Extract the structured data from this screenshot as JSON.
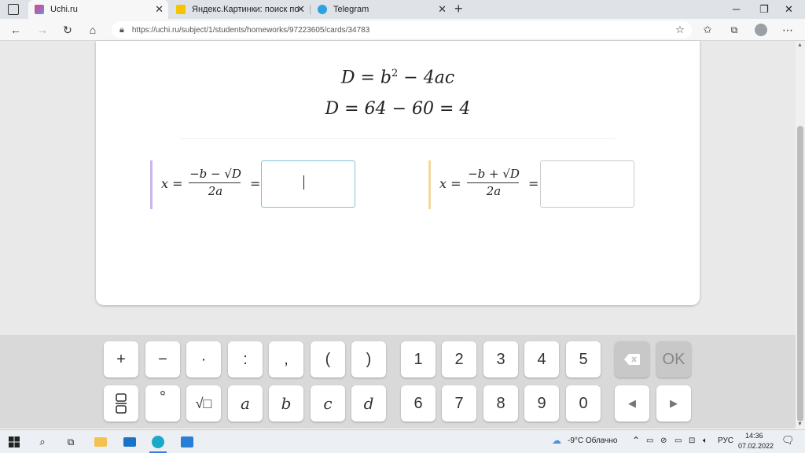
{
  "browser": {
    "tabs": [
      {
        "title": "Uchi.ru",
        "active": true,
        "color": "#e0457b"
      },
      {
        "title": "Яндекс.Картинки: поиск по изо",
        "active": false,
        "color": "#f5c400"
      },
      {
        "title": "Telegram",
        "active": false,
        "color": "#2aa3df"
      }
    ],
    "url": "https://uchi.ru/subject/1/students/homeworks/97223605/cards/34783"
  },
  "content": {
    "discriminant_formula": {
      "left": "D = b",
      "exp": "2",
      "right": " − 4ac"
    },
    "discriminant_value": "D = 64 − 60  = 4",
    "root1": {
      "prefix": "x =",
      "numerator": "−b − √D",
      "denominator": "2a",
      "equals": "=",
      "accent": "#c9b6ee",
      "value": ""
    },
    "root2": {
      "prefix": "x =",
      "numerator": "−b + √D",
      "denominator": "2a",
      "equals": "=",
      "accent": "#f3d9a0",
      "value": ""
    }
  },
  "keyboard": {
    "row1": [
      "+",
      "−",
      "·",
      ":",
      ",",
      "(",
      ")"
    ],
    "digits_row1": [
      "1",
      "2",
      "3",
      "4",
      "5"
    ],
    "row2": [
      "frac",
      "°",
      "√□",
      "a",
      "b",
      "c",
      "d"
    ],
    "digits_row2": [
      "6",
      "7",
      "8",
      "9",
      "0"
    ],
    "ok_label": "OK",
    "degree_label": "°",
    "sqrt_label": "√□",
    "backspace_icon": "backspace-icon",
    "left_arrow": "◀",
    "right_arrow": "▶"
  },
  "taskbar": {
    "weather": "-9°C  Облачно",
    "lang": "РУС",
    "time": "14:36",
    "date": "07.02.2022"
  }
}
